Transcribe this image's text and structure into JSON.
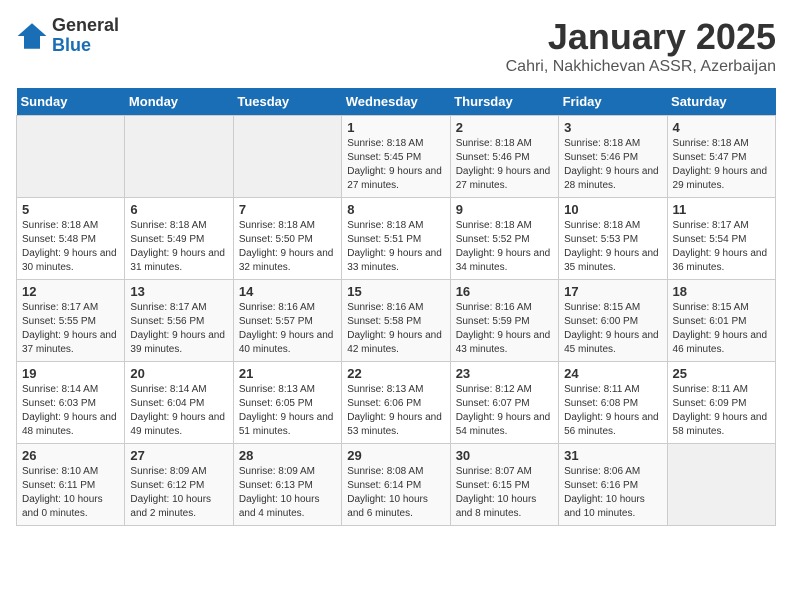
{
  "header": {
    "logo_general": "General",
    "logo_blue": "Blue",
    "title": "January 2025",
    "subtitle": "Cahri, Nakhichevan ASSR, Azerbaijan"
  },
  "days_of_week": [
    "Sunday",
    "Monday",
    "Tuesday",
    "Wednesday",
    "Thursday",
    "Friday",
    "Saturday"
  ],
  "weeks": [
    [
      {
        "day": "",
        "info": ""
      },
      {
        "day": "",
        "info": ""
      },
      {
        "day": "",
        "info": ""
      },
      {
        "day": "1",
        "info": "Sunrise: 8:18 AM\nSunset: 5:45 PM\nDaylight: 9 hours and 27 minutes."
      },
      {
        "day": "2",
        "info": "Sunrise: 8:18 AM\nSunset: 5:46 PM\nDaylight: 9 hours and 27 minutes."
      },
      {
        "day": "3",
        "info": "Sunrise: 8:18 AM\nSunset: 5:46 PM\nDaylight: 9 hours and 28 minutes."
      },
      {
        "day": "4",
        "info": "Sunrise: 8:18 AM\nSunset: 5:47 PM\nDaylight: 9 hours and 29 minutes."
      }
    ],
    [
      {
        "day": "5",
        "info": "Sunrise: 8:18 AM\nSunset: 5:48 PM\nDaylight: 9 hours and 30 minutes."
      },
      {
        "day": "6",
        "info": "Sunrise: 8:18 AM\nSunset: 5:49 PM\nDaylight: 9 hours and 31 minutes."
      },
      {
        "day": "7",
        "info": "Sunrise: 8:18 AM\nSunset: 5:50 PM\nDaylight: 9 hours and 32 minutes."
      },
      {
        "day": "8",
        "info": "Sunrise: 8:18 AM\nSunset: 5:51 PM\nDaylight: 9 hours and 33 minutes."
      },
      {
        "day": "9",
        "info": "Sunrise: 8:18 AM\nSunset: 5:52 PM\nDaylight: 9 hours and 34 minutes."
      },
      {
        "day": "10",
        "info": "Sunrise: 8:18 AM\nSunset: 5:53 PM\nDaylight: 9 hours and 35 minutes."
      },
      {
        "day": "11",
        "info": "Sunrise: 8:17 AM\nSunset: 5:54 PM\nDaylight: 9 hours and 36 minutes."
      }
    ],
    [
      {
        "day": "12",
        "info": "Sunrise: 8:17 AM\nSunset: 5:55 PM\nDaylight: 9 hours and 37 minutes."
      },
      {
        "day": "13",
        "info": "Sunrise: 8:17 AM\nSunset: 5:56 PM\nDaylight: 9 hours and 39 minutes."
      },
      {
        "day": "14",
        "info": "Sunrise: 8:16 AM\nSunset: 5:57 PM\nDaylight: 9 hours and 40 minutes."
      },
      {
        "day": "15",
        "info": "Sunrise: 8:16 AM\nSunset: 5:58 PM\nDaylight: 9 hours and 42 minutes."
      },
      {
        "day": "16",
        "info": "Sunrise: 8:16 AM\nSunset: 5:59 PM\nDaylight: 9 hours and 43 minutes."
      },
      {
        "day": "17",
        "info": "Sunrise: 8:15 AM\nSunset: 6:00 PM\nDaylight: 9 hours and 45 minutes."
      },
      {
        "day": "18",
        "info": "Sunrise: 8:15 AM\nSunset: 6:01 PM\nDaylight: 9 hours and 46 minutes."
      }
    ],
    [
      {
        "day": "19",
        "info": "Sunrise: 8:14 AM\nSunset: 6:03 PM\nDaylight: 9 hours and 48 minutes."
      },
      {
        "day": "20",
        "info": "Sunrise: 8:14 AM\nSunset: 6:04 PM\nDaylight: 9 hours and 49 minutes."
      },
      {
        "day": "21",
        "info": "Sunrise: 8:13 AM\nSunset: 6:05 PM\nDaylight: 9 hours and 51 minutes."
      },
      {
        "day": "22",
        "info": "Sunrise: 8:13 AM\nSunset: 6:06 PM\nDaylight: 9 hours and 53 minutes."
      },
      {
        "day": "23",
        "info": "Sunrise: 8:12 AM\nSunset: 6:07 PM\nDaylight: 9 hours and 54 minutes."
      },
      {
        "day": "24",
        "info": "Sunrise: 8:11 AM\nSunset: 6:08 PM\nDaylight: 9 hours and 56 minutes."
      },
      {
        "day": "25",
        "info": "Sunrise: 8:11 AM\nSunset: 6:09 PM\nDaylight: 9 hours and 58 minutes."
      }
    ],
    [
      {
        "day": "26",
        "info": "Sunrise: 8:10 AM\nSunset: 6:11 PM\nDaylight: 10 hours and 0 minutes."
      },
      {
        "day": "27",
        "info": "Sunrise: 8:09 AM\nSunset: 6:12 PM\nDaylight: 10 hours and 2 minutes."
      },
      {
        "day": "28",
        "info": "Sunrise: 8:09 AM\nSunset: 6:13 PM\nDaylight: 10 hours and 4 minutes."
      },
      {
        "day": "29",
        "info": "Sunrise: 8:08 AM\nSunset: 6:14 PM\nDaylight: 10 hours and 6 minutes."
      },
      {
        "day": "30",
        "info": "Sunrise: 8:07 AM\nSunset: 6:15 PM\nDaylight: 10 hours and 8 minutes."
      },
      {
        "day": "31",
        "info": "Sunrise: 8:06 AM\nSunset: 6:16 PM\nDaylight: 10 hours and 10 minutes."
      },
      {
        "day": "",
        "info": ""
      }
    ]
  ]
}
